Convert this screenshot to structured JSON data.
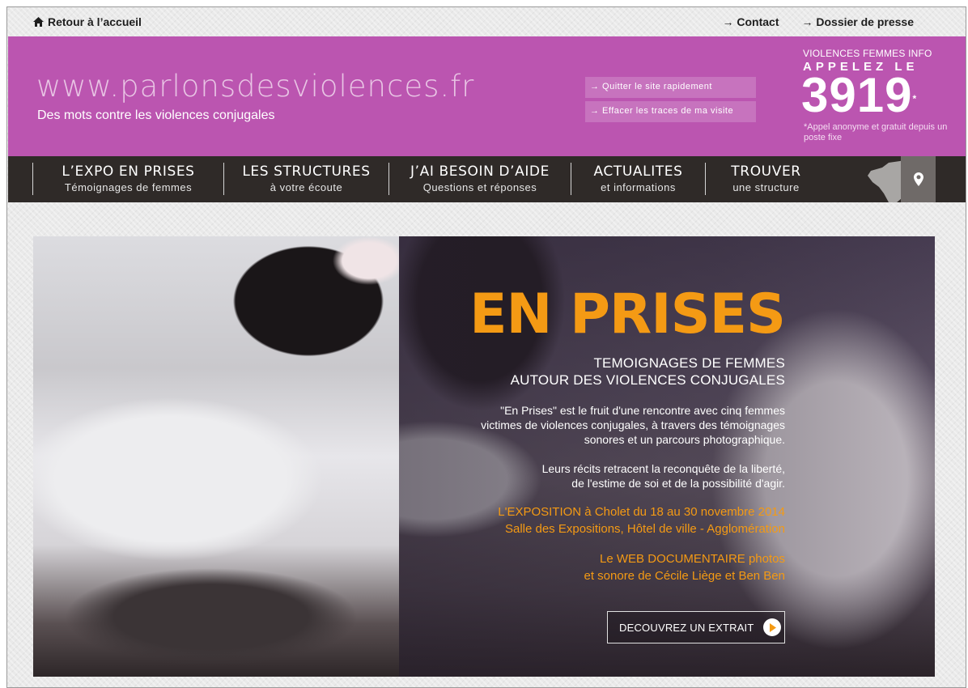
{
  "topbar": {
    "home_label": "Retour à l’accueil",
    "links": [
      "→ Contact",
      "→ Dossier de presse"
    ]
  },
  "header": {
    "site_url": "www.parlonsdesviolences.fr",
    "tagline": "Des mots contre les violences conjugales",
    "quick_exit": "→ Quitter le site rapidement",
    "clear_traces": "→ Effacer les traces de ma visite",
    "hotline": {
      "line1": "VIOLENCES FEMMES INFO",
      "line2": "APPELEZ LE",
      "number": "3919",
      "asterisk": "*",
      "note": "*Appel anonyme et gratuit depuis un poste fixe"
    }
  },
  "nav": {
    "items": [
      {
        "title": "L’EXPO EN PRISES",
        "sub": "Témoignages de femmes"
      },
      {
        "title": "LES STRUCTURES",
        "sub": "à votre écoute"
      },
      {
        "title": "J’AI BESOIN D’AIDE",
        "sub": "Questions et réponses"
      },
      {
        "title": "ACTUALITES",
        "sub": "et informations"
      },
      {
        "title": "TROUVER",
        "sub": "une structure"
      }
    ]
  },
  "hero": {
    "title": "EN PRISES",
    "subtitle_l1": "TEMOIGNAGES DE FEMMES",
    "subtitle_l2": "AUTOUR DES VIOLENCES CONJUGALES",
    "p1_l1": "\"En Prises\" est le fruit d'une rencontre avec cinq femmes",
    "p1_l2": "victimes de violences conjugales, à travers des témoignages",
    "p1_l3": "sonores et un parcours photographique.",
    "p2_l1": "Leurs récits retracent la reconquête de la liberté,",
    "p2_l2": "de l'estime de soi et de la possibilité d'agir.",
    "expo_l1": "L'EXPOSITION à Cholet du 18 au 30 novembre 2014",
    "expo_l2": "Salle des Expositions, Hôtel de ville - Agglomération",
    "web_l1": "Le WEB DOCUMENTAIRE photos",
    "web_l2": "et sonore de Cécile Liège et Ben Ben",
    "cta": "DECOUVREZ UN EXTRAIT"
  },
  "colors": {
    "header_bg": "#bb55b0",
    "nav_bg": "#2f2a28",
    "accent_orange": "#f49a14"
  },
  "icons": {
    "home": "home-icon",
    "map": "france-map-icon",
    "pin": "map-pin-icon",
    "play": "play-icon"
  }
}
